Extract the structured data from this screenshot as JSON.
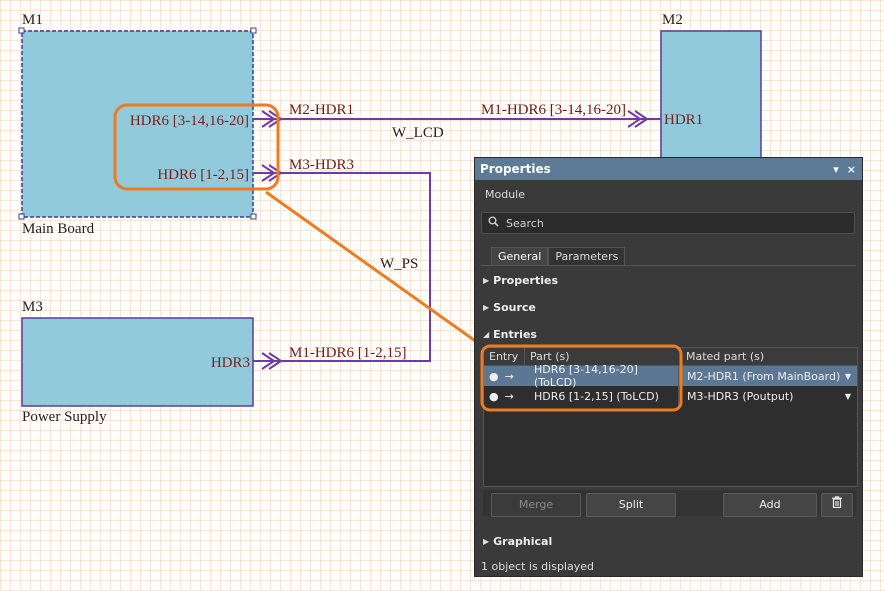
{
  "schematic": {
    "modules": [
      {
        "designator": "M1",
        "name": "Main Board",
        "ports": [
          "HDR6 [3-14,16-20]",
          "HDR6 [1-2,15]"
        ]
      },
      {
        "designator": "M2",
        "name": "",
        "ports": [
          "HDR1"
        ]
      },
      {
        "designator": "M3",
        "name": "Power Supply",
        "ports": [
          "HDR3"
        ]
      }
    ],
    "nets": {
      "m2_hdr1": "M2-HDR1",
      "m3_hdr3": "M3-HDR3",
      "m1_hdr6_a": "M1-HDR6 [3-14,16-20]",
      "m1_hdr6_b": "M1-HDR6 [1-2,15]",
      "w_lcd": "W_LCD",
      "w_ps": "W_PS"
    },
    "colors": {
      "module_fill": "#90cadb",
      "module_border": "#5b3a9e",
      "wire": "#6f3aa8",
      "highlight": "#ee7b1f",
      "grid": "#f2cfae"
    }
  },
  "panel": {
    "title": "Properties",
    "pin_icon": "▾",
    "close_icon": "×",
    "object_type": "Module",
    "search_placeholder": "Search",
    "tabs": [
      "General",
      "Parameters"
    ],
    "sections": {
      "properties": "Properties",
      "source": "Source",
      "entries": "Entries",
      "graphical": "Graphical"
    },
    "entries_table": {
      "headers": [
        "Entry",
        "Part (s)",
        "Mated part (s)"
      ],
      "rows": [
        {
          "part": "HDR6 [3-14,16-20] (ToLCD)",
          "mated": "M2-HDR1 (From MainBoard)",
          "selected": true
        },
        {
          "part": "HDR6 [1-2,15] (ToLCD)",
          "mated": "M3-HDR3 (Poutput)",
          "selected": false
        }
      ]
    },
    "buttons": {
      "merge": "Merge",
      "split": "Split",
      "add": "Add",
      "delete_icon": "trash-icon"
    },
    "status": "1 object is displayed"
  }
}
